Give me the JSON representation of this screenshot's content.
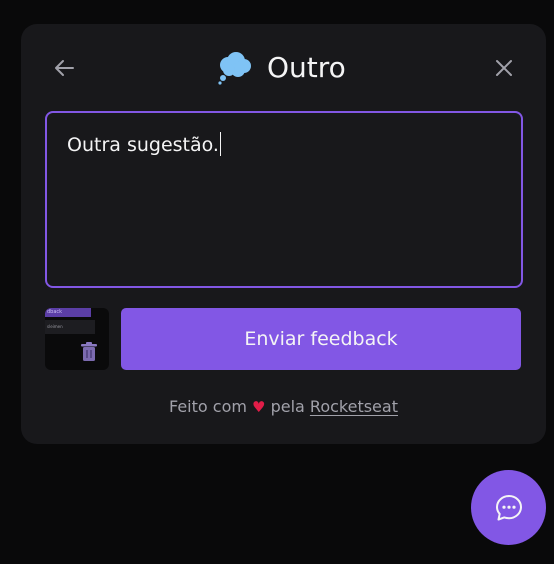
{
  "widget": {
    "title": "Outro",
    "title_icon": "thought-bubble-icon",
    "back_icon": "arrow-left-icon",
    "close_icon": "close-icon"
  },
  "feedback": {
    "text": "Outra sugestão."
  },
  "screenshot": {
    "thumb_header": "dback",
    "thumb_row": "sleimen"
  },
  "actions": {
    "send_label": "Enviar feedback"
  },
  "footer": {
    "prefix": "Feito com",
    "middle": "pela",
    "link": "Rocketseat",
    "heart_icon": "heart-icon"
  },
  "fab": {
    "icon": "chat-bubble-icon"
  },
  "colors": {
    "background": "#09090a",
    "surface": "#18181b",
    "brand": "#8257e5",
    "text": "#f4f4f5",
    "muted": "#a1a1aa",
    "heart": "#e11d48"
  }
}
